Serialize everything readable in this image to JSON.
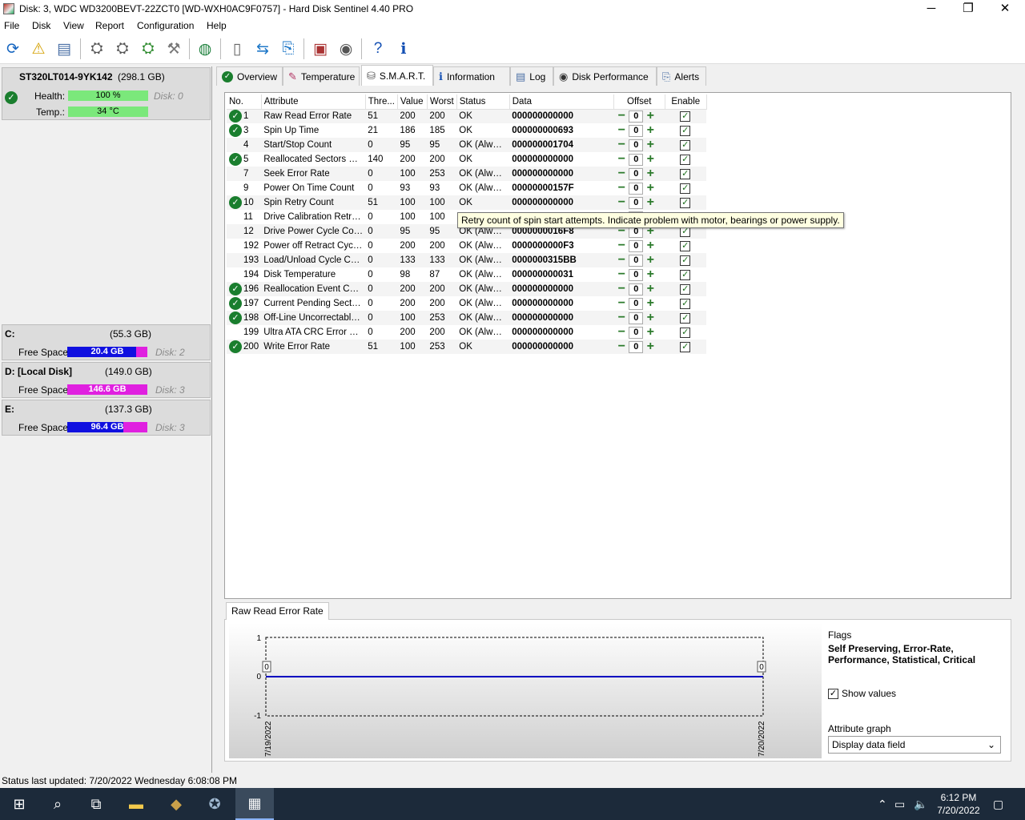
{
  "window": {
    "title": "Disk: 3, WDC WD3200BEVT-22ZCT0 [WD-WXH0AC9F0757]  -  Hard Disk Sentinel 4.40 PRO",
    "minimize": "─",
    "maximize": "❐",
    "close": "✕"
  },
  "menu": [
    "File",
    "Disk",
    "View",
    "Report",
    "Configuration",
    "Help"
  ],
  "disk": {
    "name": "ST320LT014-9YK142",
    "size": "(298.1 GB)",
    "health_label": "Health:",
    "health_value": "100 %",
    "health_fraction": 1.0,
    "disk_ref": "Disk: 0",
    "temp_label": "Temp.:",
    "temp_value": "34 °C"
  },
  "partitions": [
    {
      "name": "C:",
      "size": "(55.3 GB)",
      "label": "Free Space",
      "free": "20.4 GB",
      "disk": "Disk: 2"
    },
    {
      "name": "D: [Local Disk]",
      "size": "(149.0 GB)",
      "label": "Free Space",
      "free": "146.6 GB",
      "disk": "Disk: 3"
    },
    {
      "name": "E:",
      "size": "(137.3 GB)",
      "label": "Free Space",
      "free": "96.4 GB",
      "disk": "Disk: 3"
    }
  ],
  "tabs": [
    "Overview",
    "Temperature",
    "S.M.A.R.T.",
    "Information",
    "Log",
    "Disk Performance",
    "Alerts"
  ],
  "smart": {
    "headers": [
      "No.",
      "Attribute",
      "Thre...",
      "Value",
      "Worst",
      "Status",
      "Data",
      "Offset",
      "Enable"
    ],
    "rows": [
      {
        "ok": true,
        "no": "1",
        "attr": "Raw Read Error Rate",
        "thr": "51",
        "val": "200",
        "worst": "200",
        "status": "OK",
        "data": "000000000000",
        "offset": "0"
      },
      {
        "ok": true,
        "no": "3",
        "attr": "Spin Up Time",
        "thr": "21",
        "val": "186",
        "worst": "185",
        "status": "OK",
        "data": "000000000693",
        "offset": "0"
      },
      {
        "ok": false,
        "no": "4",
        "attr": "Start/Stop Count",
        "thr": "0",
        "val": "95",
        "worst": "95",
        "status": "OK (Always...",
        "data": "000000001704",
        "offset": "0"
      },
      {
        "ok": true,
        "no": "5",
        "attr": "Reallocated Sectors Co...",
        "thr": "140",
        "val": "200",
        "worst": "200",
        "status": "OK",
        "data": "000000000000",
        "offset": "0"
      },
      {
        "ok": false,
        "no": "7",
        "attr": "Seek Error Rate",
        "thr": "0",
        "val": "100",
        "worst": "253",
        "status": "OK (Always...",
        "data": "000000000000",
        "offset": "0"
      },
      {
        "ok": false,
        "no": "9",
        "attr": "Power On Time Count",
        "thr": "0",
        "val": "93",
        "worst": "93",
        "status": "OK (Always...",
        "data": "00000000157F",
        "offset": "0"
      },
      {
        "ok": true,
        "no": "10",
        "attr": "Spin Retry Count",
        "thr": "51",
        "val": "100",
        "worst": "100",
        "status": "OK",
        "data": "000000000000",
        "offset": "0"
      },
      {
        "ok": false,
        "no": "11",
        "attr": "Drive Calibration Retry ...",
        "thr": "0",
        "val": "100",
        "worst": "100",
        "status": "OK",
        "data": "",
        "offset": "0"
      },
      {
        "ok": false,
        "no": "12",
        "attr": "Drive Power Cycle Count",
        "thr": "0",
        "val": "95",
        "worst": "95",
        "status": "OK (Always...",
        "data": "0000000016F8",
        "offset": "0"
      },
      {
        "ok": false,
        "no": "192",
        "attr": "Power off Retract Cycle ...",
        "thr": "0",
        "val": "200",
        "worst": "200",
        "status": "OK (Always...",
        "data": "0000000000F3",
        "offset": "0"
      },
      {
        "ok": false,
        "no": "193",
        "attr": "Load/Unload Cycle Cou...",
        "thr": "0",
        "val": "133",
        "worst": "133",
        "status": "OK (Always...",
        "data": "0000000315BB",
        "offset": "0"
      },
      {
        "ok": false,
        "no": "194",
        "attr": "Disk Temperature",
        "thr": "0",
        "val": "98",
        "worst": "87",
        "status": "OK (Always...",
        "data": "000000000031",
        "offset": "0"
      },
      {
        "ok": true,
        "no": "196",
        "attr": "Reallocation Event Count",
        "thr": "0",
        "val": "200",
        "worst": "200",
        "status": "OK (Always...",
        "data": "000000000000",
        "offset": "0"
      },
      {
        "ok": true,
        "no": "197",
        "attr": "Current Pending Sector...",
        "thr": "0",
        "val": "200",
        "worst": "200",
        "status": "OK (Always...",
        "data": "000000000000",
        "offset": "0"
      },
      {
        "ok": true,
        "no": "198",
        "attr": "Off-Line Uncorrectable ...",
        "thr": "0",
        "val": "100",
        "worst": "253",
        "status": "OK (Always...",
        "data": "000000000000",
        "offset": "0"
      },
      {
        "ok": false,
        "no": "199",
        "attr": "Ultra ATA CRC Error Co...",
        "thr": "0",
        "val": "200",
        "worst": "200",
        "status": "OK (Always...",
        "data": "000000000000",
        "offset": "0"
      },
      {
        "ok": true,
        "no": "200",
        "attr": "Write Error Rate",
        "thr": "51",
        "val": "100",
        "worst": "253",
        "status": "OK",
        "data": "000000000000",
        "offset": "0"
      }
    ]
  },
  "tooltip": "Retry count of spin start attempts. Indicate problem with motor, bearings or power supply.",
  "graph": {
    "tab_label": "Raw Read Error Rate",
    "y_ticks": [
      "1",
      "0",
      "-1"
    ],
    "x_dates": [
      "7/19/2022",
      "7/20/2022"
    ],
    "point_labels": [
      "0",
      "0"
    ],
    "y_values": [
      0,
      0
    ]
  },
  "flags": {
    "title": "Flags",
    "value": "Self Preserving, Error-Rate, Performance, Statistical, Critical",
    "show_values": "Show values",
    "attr_graph_label": "Attribute graph",
    "attr_graph_value": "Display data field"
  },
  "status": "Status last updated: 7/20/2022 Wednesday 6:08:08 PM",
  "taskbar": {
    "time": "6:12 PM",
    "date": "7/20/2022"
  },
  "colors": {
    "health_bar": "#7be87b",
    "free_bar_blue": "#1010e0",
    "free_bar_magenta": "#e020e0",
    "ok_icon": "#1a7e2e",
    "graph_line": "#0000c0"
  }
}
